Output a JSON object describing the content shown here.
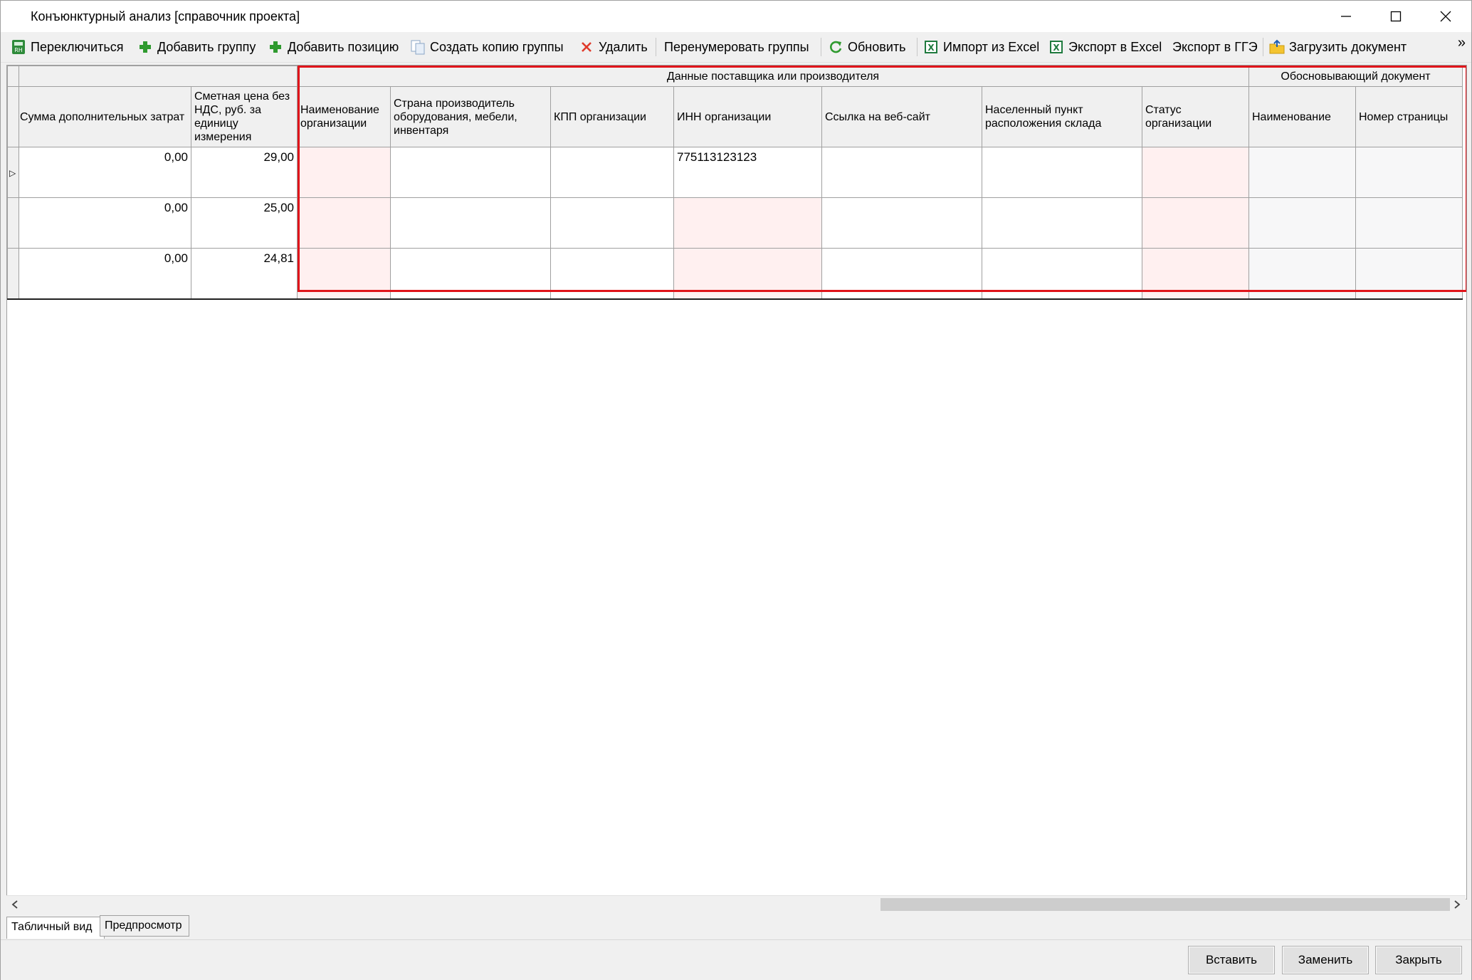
{
  "window": {
    "title": "Конъюнктурный анализ [справочник проекта]",
    "controls": [
      "minimize",
      "maximize",
      "close"
    ]
  },
  "toolbar": {
    "items": [
      {
        "label": "Переключиться",
        "icon": "switch-calc-icon"
      },
      {
        "label": "Добавить группу",
        "icon": "green-plus-icon"
      },
      {
        "label": "Добавить позицию",
        "icon": "green-plus-icon"
      },
      {
        "label": "Создать копию группы",
        "icon": "copy-icon"
      },
      {
        "label": "Удалить",
        "icon": "red-x-icon"
      },
      {
        "label": "Перенумеровать группы",
        "icon": ""
      },
      {
        "label": "Обновить",
        "icon": "refresh-icon"
      },
      {
        "label": "Импорт из Excel",
        "icon": "excel-icon"
      },
      {
        "label": "Экспорт в Excel",
        "icon": "excel-icon"
      },
      {
        "label": "Экспорт в ГГЭ",
        "icon": ""
      },
      {
        "label": "Загрузить документ",
        "icon": "folder-upload-icon"
      }
    ],
    "overflow": "»"
  },
  "grid": {
    "bands": {
      "supplier": "Данные поставщика или производителя",
      "document": "Обосновывающий документ"
    },
    "columns": [
      "Сумма дополнительных затрат",
      "Сметная цена без НДС, руб. за единицу измерения",
      "Наименование организации",
      "Страна производитель оборудования, мебели, инвентаря",
      "КПП организации",
      "ИНН организации",
      "Ссылка на веб-сайт",
      "Населенный пункт расположения склада",
      "Статус организации",
      "Наименование",
      "Номер страницы"
    ],
    "rows": [
      {
        "extra_cost": "0,00",
        "price": "29,00",
        "inn": "775113123123",
        "selected": true
      },
      {
        "extra_cost": "0,00",
        "price": "25,00",
        "inn": "",
        "selected": false
      },
      {
        "extra_cost": "0,00",
        "price": "24,81",
        "inn": "",
        "selected": false
      }
    ],
    "row_indicator": "▷",
    "invalid_fill_color": "#fff0f0",
    "highlight_color": "#e0141a"
  },
  "tabs": [
    "Табличный вид",
    "Предпросмотр"
  ],
  "active_tab": "Табличный вид",
  "buttons": {
    "insert": "Вставить",
    "replace": "Заменить",
    "close": "Закрыть"
  }
}
